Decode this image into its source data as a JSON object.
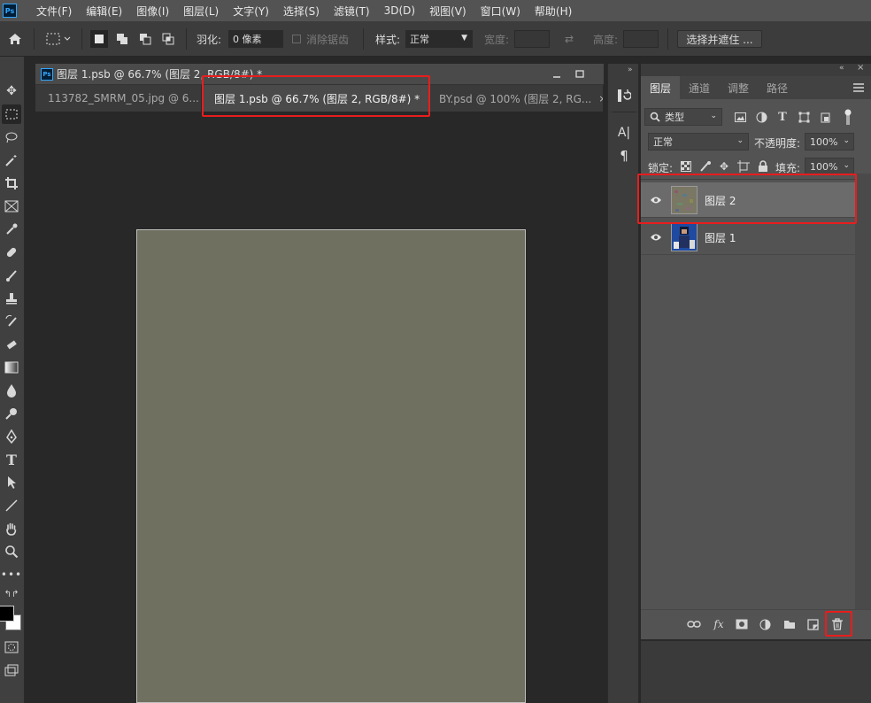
{
  "menu": [
    "文件(F)",
    "编辑(E)",
    "图像(I)",
    "图层(L)",
    "文字(Y)",
    "选择(S)",
    "滤镜(T)",
    "3D(D)",
    "视图(V)",
    "窗口(W)",
    "帮助(H)"
  ],
  "app_logo": "Ps",
  "options": {
    "feather_label": "羽化:",
    "feather_value": "0 像素",
    "antialias_label": "消除锯齿",
    "style_label": "样式:",
    "style_value": "正常",
    "width_label": "宽度:",
    "height_label": "高度:",
    "select_mask_button": "选择并遮住 ..."
  },
  "document": {
    "window_title": "图层 1.psb @ 66.7% (图层 2, RGB/8#) *",
    "tabs": [
      {
        "label": "113782_SMRM_05.jpg @ 6...",
        "close": "×"
      },
      {
        "label": "图层 1.psb @ 66.7% (图层 2, RGB/8#) *",
        "close": "×"
      },
      {
        "label": "BY.psd @ 100% (图层 2, RG...",
        "close": "×"
      }
    ],
    "canvas_image": "assets/noise.png"
  },
  "layers_panel": {
    "tabs": [
      "图层",
      "通道",
      "调整",
      "路径"
    ],
    "filter_kind": "类型",
    "blend_mode": "正常",
    "opacity_label": "不透明度:",
    "opacity_value": "100%",
    "lock_label": "锁定:",
    "fill_label": "填充:",
    "fill_value": "100%",
    "layers": [
      {
        "name": "图层 2",
        "selected": true
      },
      {
        "name": "图层 1",
        "selected": false
      }
    ],
    "footer_fx": "fx"
  },
  "dock_text_icon": "A|",
  "highlight_color": "#e81d1d"
}
